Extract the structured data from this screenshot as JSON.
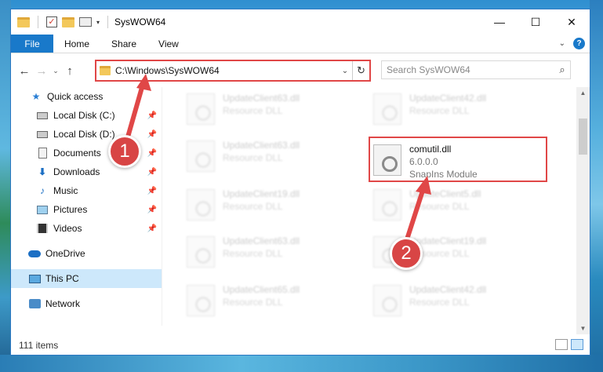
{
  "window": {
    "title": "SysWOW64",
    "controls": {
      "minimize": "—",
      "maximize": "☐",
      "close": "✕"
    }
  },
  "ribbon": {
    "tabs": [
      "File",
      "Home",
      "Share",
      "View"
    ],
    "help": "?"
  },
  "navigation": {
    "address": "C:\\Windows\\SysWOW64",
    "search_placeholder": "Search SysWOW64"
  },
  "sidebar": {
    "items": [
      {
        "label": "Quick access",
        "icon": "star-icon"
      },
      {
        "label": "Local Disk (C:)",
        "icon": "drive-icon",
        "pinned": true
      },
      {
        "label": "Local Disk (D:)",
        "icon": "drive-icon",
        "pinned": true
      },
      {
        "label": "Documents",
        "icon": "document-icon",
        "pinned": true
      },
      {
        "label": "Downloads",
        "icon": "download-icon",
        "pinned": true
      },
      {
        "label": "Music",
        "icon": "music-icon",
        "pinned": true
      },
      {
        "label": "Pictures",
        "icon": "pictures-icon",
        "pinned": true
      },
      {
        "label": "Videos",
        "icon": "videos-icon",
        "pinned": true
      },
      {
        "label": "OneDrive",
        "icon": "cloud-icon"
      },
      {
        "label": "This PC",
        "icon": "computer-icon",
        "selected": true
      },
      {
        "label": "Network",
        "icon": "network-icon"
      }
    ]
  },
  "files": [
    {
      "name": "UpdateClient63.dll",
      "type": "Resource DLL"
    },
    {
      "name": "UpdateClient42.dll",
      "type": "Resource DLL"
    },
    {
      "name": "UpdateClient63.dll",
      "type": "Resource DLL"
    },
    {
      "name": "comutil.dll",
      "version": "6.0.0.0",
      "type": "SnapIns Module",
      "highlighted": true
    },
    {
      "name": "UpdateClient19.dll",
      "type": "Resource DLL"
    },
    {
      "name": "UpdateClient5.dll",
      "type": "Resource DLL"
    },
    {
      "name": "UpdateClient63.dll",
      "type": "Resource DLL"
    },
    {
      "name": "UpdateClient19.dll",
      "type": "Resource DLL"
    },
    {
      "name": "UpdateClient65.dll",
      "type": "Resource DLL"
    },
    {
      "name": "UpdateClient42.dll",
      "type": "Resource DLL"
    }
  ],
  "status": {
    "item_count": "111 items"
  },
  "callouts": {
    "step1": "1",
    "step2": "2"
  },
  "colors": {
    "accent": "#1979ca",
    "highlight": "#e04747",
    "selected_bg": "#cde8fb"
  }
}
